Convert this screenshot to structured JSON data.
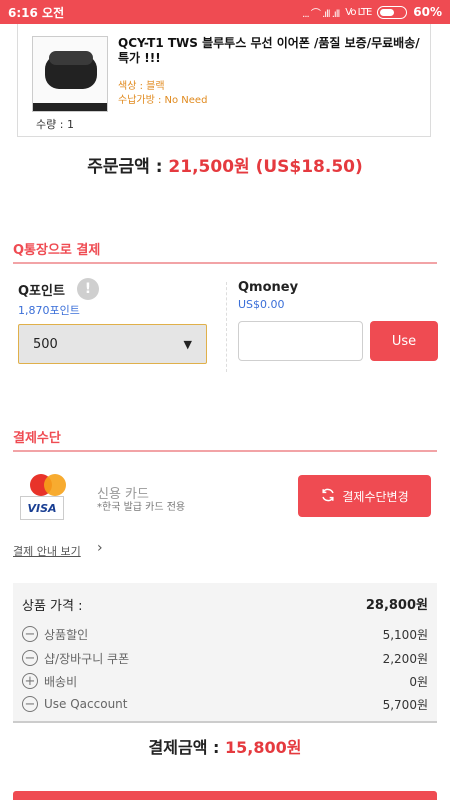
{
  "status_bar": {
    "time": "6:16 오전",
    "signal_icons": "... ⌒ .ıll .ıll",
    "lte_label": "Vo LTE",
    "battery_percent_text": "60%",
    "battery_level": 0.6
  },
  "product": {
    "title": "QCY-T1 TWS 블루투스 무선 이어폰 /품질 보증/무료배송/특가 !!!",
    "option_color": "색상 : 블랙",
    "option_delivery": "수납가방 : No Need",
    "quantity": "수량 : 1"
  },
  "order_amount": {
    "label": "주문금액 : ",
    "value": "21,500원 (US$18.50)"
  },
  "qbank": {
    "section_title": "Q통장으로 결제",
    "qpoint_label": "Q포인트",
    "qpoint_info_icon": "!",
    "qpoint_balance": "1,870포인트",
    "qpoint_selected": "500",
    "qmoney_label": "Qmoney",
    "qmoney_balance": "US$0.00",
    "qmoney_input_value": "",
    "use_button": "Use"
  },
  "payment_method": {
    "section_title": "결제수단",
    "card_name": "신용 카드",
    "card_sub": "*한국 발급 카드 전용",
    "change_button": "결제수단변경",
    "mastercard_label": "MasterCard",
    "visa_label": "VISA",
    "guide_link": "결제 안내 보기"
  },
  "summary": {
    "price_label": "상품 가격 :",
    "price_value": "28,800원",
    "rows": [
      {
        "sign": "−",
        "label": "상품할인",
        "amount": "5,100원"
      },
      {
        "sign": "−",
        "label": "샵/장바구니 쿠폰",
        "amount": "2,200원"
      },
      {
        "sign": "+",
        "label": "배송비",
        "amount": "0원"
      },
      {
        "sign": "−",
        "label": "Use Qaccount",
        "amount": "5,700원"
      }
    ]
  },
  "final_amount": {
    "label": "결제금액 : ",
    "value": "15,800원"
  },
  "colors": {
    "accent": "#ef4b52",
    "price_red": "#e53a3f",
    "link_blue": "#3b6fd8",
    "option_orange": "#e08a1e"
  }
}
